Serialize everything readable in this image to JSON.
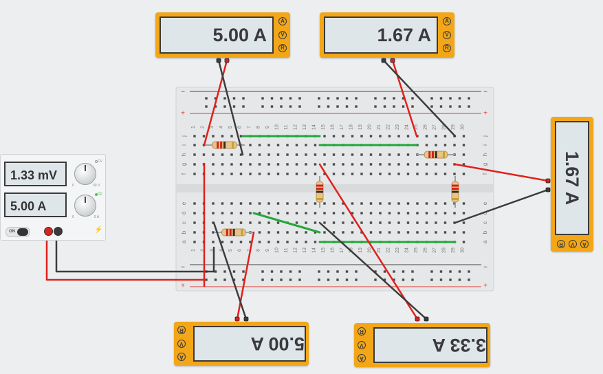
{
  "meters": {
    "top_left": {
      "reading": "5.00 A",
      "buttons": [
        "A",
        "V",
        "R"
      ]
    },
    "top_right": {
      "reading": "1.67 A",
      "buttons": [
        "A",
        "V",
        "R"
      ]
    },
    "right": {
      "reading": "1.67 A",
      "buttons": [
        "A",
        "V",
        "R"
      ]
    },
    "bottom_left": {
      "reading": "5.00 A",
      "buttons": [
        "A",
        "V",
        "R"
      ]
    },
    "bottom_right": {
      "reading": "3.33 A",
      "buttons": [
        "A",
        "V",
        "R"
      ]
    }
  },
  "power_supply": {
    "voltage_display": "1.33 mV",
    "current_display": "5.00 A",
    "switch_label": "ON",
    "knob_cv_label": "CV",
    "knob_cc_label": "CC",
    "voltage_range": [
      "0",
      "30 V"
    ],
    "current_range": [
      "0",
      "5 A"
    ]
  },
  "breadboard": {
    "columns": 30,
    "row_letters_top": [
      "j",
      "i",
      "h",
      "g",
      "f"
    ],
    "row_letters_bottom": [
      "e",
      "d",
      "c",
      "b",
      "a"
    ],
    "rail_minus": "−",
    "rail_plus": "+"
  },
  "colors": {
    "board": "#e6e7e8",
    "wire_red": "#e0201c",
    "wire_black": "#3c3c3c",
    "wire_green": "#22a83a",
    "meter_orange": "#f2a618",
    "lcd": "#dfe6ea"
  }
}
